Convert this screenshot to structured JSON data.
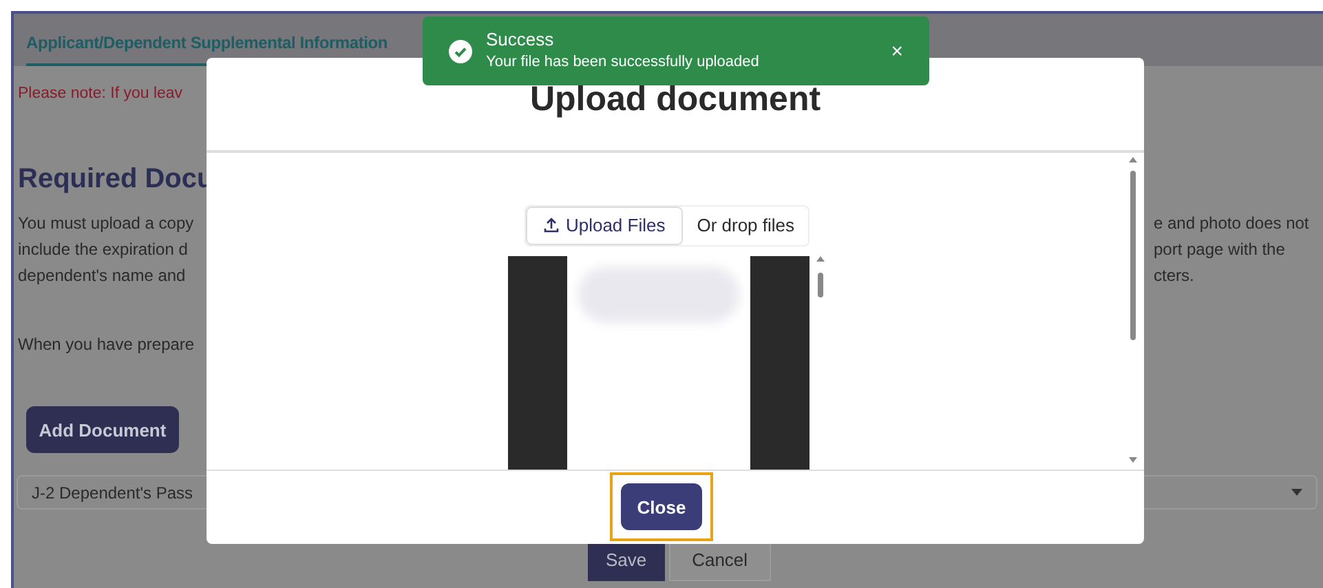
{
  "page": {
    "tabs": [
      {
        "label": "Applicant/Dependent Supplemental Information",
        "selected": true
      }
    ],
    "note": "Please note: If you leav",
    "heading": "Required Docu",
    "paragraph_lines": [
      {
        "left": "You must upload a copy",
        "right": "e and photo does not"
      },
      {
        "left": "include the expiration d",
        "right": "port page with the"
      },
      {
        "left": "dependent's name and",
        "right": "cters."
      }
    ],
    "prepare_text": "When you have prepare",
    "add_button": "Add Document",
    "document_select": {
      "value": "J-2 Dependent's Pass"
    },
    "buttons": [
      {
        "label": "Save",
        "kind": "primary"
      },
      {
        "label": "Cancel",
        "kind": "secondary"
      }
    ]
  },
  "modal": {
    "title": "Upload document",
    "upload_button": "Upload Files",
    "drop_text": "Or drop files",
    "close_button": "Close",
    "close_focused": true
  },
  "toast": {
    "title": "Success",
    "message": "Your file has been successfully uploaded",
    "close": "×"
  }
}
